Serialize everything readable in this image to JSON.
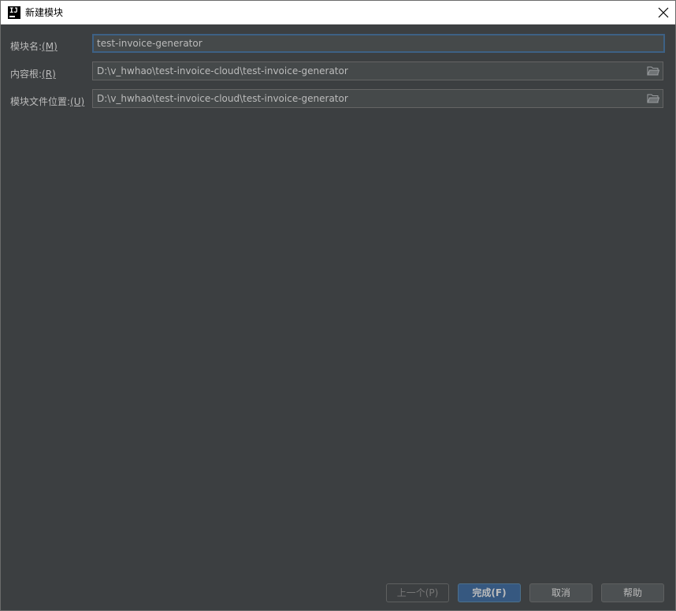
{
  "window": {
    "title": "新建模块",
    "app_icon_text": "IJ"
  },
  "form": {
    "module_name": {
      "label": "模块名:",
      "mnemonic": "(M)",
      "value": "test-invoice-generator"
    },
    "content_root": {
      "label": "内容根:",
      "mnemonic": "(R)",
      "value": "D:\\v_hwhao\\test-invoice-cloud\\test-invoice-generator"
    },
    "module_file_location": {
      "label": "模块文件位置:",
      "mnemonic": "(U)",
      "value": "D:\\v_hwhao\\test-invoice-cloud\\test-invoice-generator"
    }
  },
  "buttons": {
    "previous": "上一个(P)",
    "finish": "完成(F)",
    "cancel": "取消",
    "help": "帮助"
  },
  "colors": {
    "background": "#3c3f41",
    "field_background": "#45494a",
    "focus_border": "#3d6185",
    "default_button": "#365880",
    "text": "#bbbbbb"
  },
  "icons": {
    "app": "intellij-idea-icon",
    "close": "close-icon",
    "browse": "folder-icon"
  }
}
